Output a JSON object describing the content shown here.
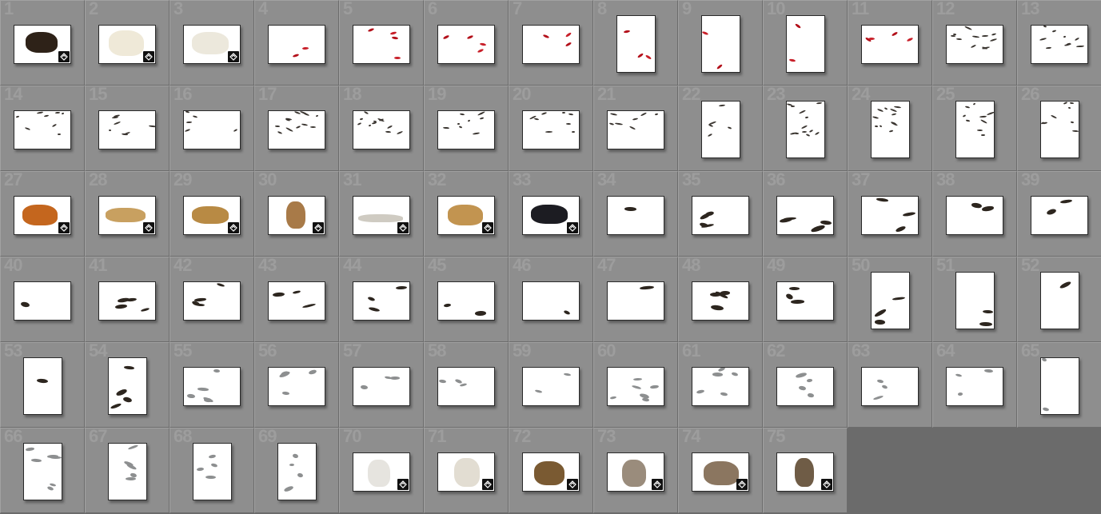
{
  "window": {
    "title": ""
  },
  "colors": {
    "cell_bg": "#8e8e8e",
    "frame_bg": "#6b6b6b",
    "thumb_bg": "#ffffff",
    "badge": "#111111"
  },
  "grid": {
    "columns": 13,
    "cells": [
      {
        "n": "1",
        "o": "land",
        "kind": "bear",
        "badge": true
      },
      {
        "n": "2",
        "o": "land",
        "kind": "polarbear",
        "badge": true
      },
      {
        "n": "3",
        "o": "land",
        "kind": "polarbear2",
        "badge": true
      },
      {
        "n": "4",
        "o": "land",
        "kind": "fish",
        "badge": false
      },
      {
        "n": "5",
        "o": "land",
        "kind": "fish",
        "badge": false
      },
      {
        "n": "6",
        "o": "land",
        "kind": "fish",
        "badge": false
      },
      {
        "n": "7",
        "o": "land",
        "kind": "fish",
        "badge": false
      },
      {
        "n": "8",
        "o": "port",
        "kind": "fish",
        "badge": false
      },
      {
        "n": "9",
        "o": "port",
        "kind": "fish",
        "badge": false
      },
      {
        "n": "10",
        "o": "port",
        "kind": "fish",
        "badge": false
      },
      {
        "n": "11",
        "o": "land",
        "kind": "fish",
        "badge": false
      },
      {
        "n": "12",
        "o": "land",
        "kind": "birds",
        "badge": false
      },
      {
        "n": "13",
        "o": "land",
        "kind": "birds",
        "badge": false
      },
      {
        "n": "14",
        "o": "land",
        "kind": "birds",
        "badge": false
      },
      {
        "n": "15",
        "o": "land",
        "kind": "birds",
        "badge": false
      },
      {
        "n": "16",
        "o": "land",
        "kind": "birds",
        "badge": false
      },
      {
        "n": "17",
        "o": "land",
        "kind": "birds",
        "badge": false
      },
      {
        "n": "18",
        "o": "land",
        "kind": "birds",
        "badge": false
      },
      {
        "n": "19",
        "o": "land",
        "kind": "birds",
        "badge": false
      },
      {
        "n": "20",
        "o": "land",
        "kind": "birds",
        "badge": false
      },
      {
        "n": "21",
        "o": "land",
        "kind": "birds",
        "badge": false
      },
      {
        "n": "22",
        "o": "port",
        "kind": "birds",
        "badge": false
      },
      {
        "n": "23",
        "o": "port",
        "kind": "birds",
        "badge": false
      },
      {
        "n": "24",
        "o": "port",
        "kind": "birds",
        "badge": false
      },
      {
        "n": "25",
        "o": "port",
        "kind": "birds",
        "badge": false
      },
      {
        "n": "26",
        "o": "port",
        "kind": "birds",
        "badge": false
      },
      {
        "n": "27",
        "o": "land",
        "kind": "fox",
        "badge": true
      },
      {
        "n": "28",
        "o": "land",
        "kind": "cheetah",
        "badge": true
      },
      {
        "n": "29",
        "o": "land",
        "kind": "leopard",
        "badge": true
      },
      {
        "n": "30",
        "o": "land",
        "kind": "puma",
        "badge": true
      },
      {
        "n": "31",
        "o": "land",
        "kind": "snowleopard",
        "badge": true
      },
      {
        "n": "32",
        "o": "land",
        "kind": "leopard2",
        "badge": true
      },
      {
        "n": "33",
        "o": "land",
        "kind": "panther",
        "badge": true
      },
      {
        "n": "34",
        "o": "land",
        "kind": "raptor",
        "badge": false
      },
      {
        "n": "35",
        "o": "land",
        "kind": "raptor",
        "badge": false
      },
      {
        "n": "36",
        "o": "land",
        "kind": "raptor",
        "badge": false
      },
      {
        "n": "37",
        "o": "land",
        "kind": "raptor",
        "badge": false
      },
      {
        "n": "38",
        "o": "land",
        "kind": "raptor",
        "badge": false
      },
      {
        "n": "39",
        "o": "land",
        "kind": "raptor",
        "badge": false
      },
      {
        "n": "40",
        "o": "land",
        "kind": "raptor",
        "badge": false
      },
      {
        "n": "41",
        "o": "land",
        "kind": "raptor",
        "badge": false
      },
      {
        "n": "42",
        "o": "land",
        "kind": "raptor",
        "badge": false
      },
      {
        "n": "43",
        "o": "land",
        "kind": "raptor",
        "badge": false
      },
      {
        "n": "44",
        "o": "land",
        "kind": "raptor",
        "badge": false
      },
      {
        "n": "45",
        "o": "land",
        "kind": "raptor",
        "badge": false
      },
      {
        "n": "46",
        "o": "land",
        "kind": "raptor",
        "badge": false
      },
      {
        "n": "47",
        "o": "land",
        "kind": "raptor",
        "badge": false
      },
      {
        "n": "48",
        "o": "land",
        "kind": "raptor",
        "badge": false
      },
      {
        "n": "49",
        "o": "land",
        "kind": "raptor",
        "badge": false
      },
      {
        "n": "50",
        "o": "port",
        "kind": "raptor",
        "badge": false
      },
      {
        "n": "51",
        "o": "port",
        "kind": "raptor",
        "badge": false
      },
      {
        "n": "52",
        "o": "port",
        "kind": "raptor",
        "badge": false
      },
      {
        "n": "53",
        "o": "port",
        "kind": "raptor",
        "badge": false
      },
      {
        "n": "54",
        "o": "port",
        "kind": "raptor",
        "badge": false
      },
      {
        "n": "55",
        "o": "land",
        "kind": "gulls",
        "badge": false
      },
      {
        "n": "56",
        "o": "land",
        "kind": "gulls",
        "badge": false
      },
      {
        "n": "57",
        "o": "land",
        "kind": "gulls",
        "badge": false
      },
      {
        "n": "58",
        "o": "land",
        "kind": "gulls",
        "badge": false
      },
      {
        "n": "59",
        "o": "land",
        "kind": "gulls",
        "badge": false
      },
      {
        "n": "60",
        "o": "land",
        "kind": "gulls",
        "badge": false
      },
      {
        "n": "61",
        "o": "land",
        "kind": "gulls",
        "badge": false
      },
      {
        "n": "62",
        "o": "land",
        "kind": "gulls",
        "badge": false
      },
      {
        "n": "63",
        "o": "land",
        "kind": "gulls",
        "badge": false
      },
      {
        "n": "64",
        "o": "land",
        "kind": "gulls",
        "badge": false
      },
      {
        "n": "65",
        "o": "port",
        "kind": "gulls",
        "badge": false
      },
      {
        "n": "66",
        "o": "port",
        "kind": "gulls",
        "badge": false
      },
      {
        "n": "67",
        "o": "port",
        "kind": "gulls",
        "badge": false
      },
      {
        "n": "68",
        "o": "port",
        "kind": "gulls",
        "badge": false
      },
      {
        "n": "69",
        "o": "port",
        "kind": "gulls",
        "badge": false
      },
      {
        "n": "70",
        "o": "land",
        "kind": "whitetiger",
        "badge": true
      },
      {
        "n": "71",
        "o": "land",
        "kind": "whitetiger2",
        "badge": true
      },
      {
        "n": "72",
        "o": "land",
        "kind": "wilddog",
        "badge": true
      },
      {
        "n": "73",
        "o": "land",
        "kind": "wolf",
        "badge": true
      },
      {
        "n": "74",
        "o": "land",
        "kind": "wolf2",
        "badge": true
      },
      {
        "n": "75",
        "o": "land",
        "kind": "wolf3",
        "badge": true
      }
    ]
  }
}
